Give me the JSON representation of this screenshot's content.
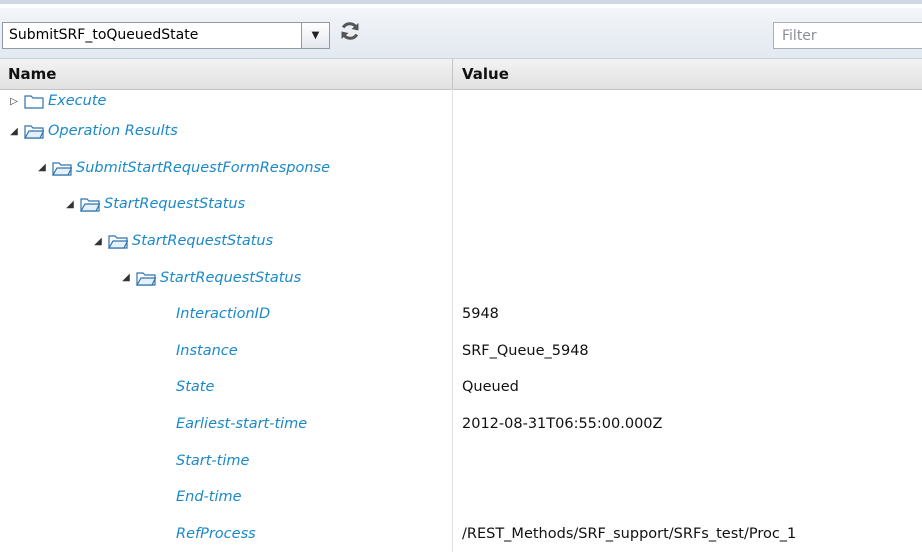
{
  "toolbar": {
    "selected_operation": "SubmitSRF_toQueuedState",
    "filter_placeholder": "Filter",
    "refresh_icon": "refresh-icon"
  },
  "table": {
    "columns": {
      "name": "Name",
      "value": "Value"
    },
    "rows": [
      {
        "label": "Execute",
        "value": "",
        "expander": "collapsed",
        "folder": true
      },
      {
        "label": "Operation Results",
        "value": "",
        "expander": "expanded",
        "folder": true
      },
      {
        "label": "SubmitStartRequestFormResponse",
        "value": "",
        "expander": "expanded",
        "folder": true
      },
      {
        "label": "StartRequestStatus",
        "value": "",
        "expander": "expanded",
        "folder": true
      },
      {
        "label": "StartRequestStatus",
        "value": "",
        "expander": "expanded",
        "folder": true
      },
      {
        "label": "StartRequestStatus",
        "value": "",
        "expander": "expanded",
        "folder": true
      },
      {
        "label": "InteractionID",
        "value": "5948"
      },
      {
        "label": "Instance",
        "value": "SRF_Queue_5948"
      },
      {
        "label": "State",
        "value": "Queued"
      },
      {
        "label": "Earliest-start-time",
        "value": "2012-08-31T06:55:00.000Z"
      },
      {
        "label": "Start-time",
        "value": ""
      },
      {
        "label": "End-time",
        "value": ""
      },
      {
        "label": "RefProcess",
        "value": "/REST_Methods/SRF_support/SRFs_test/Proc_1"
      }
    ]
  },
  "colors": {
    "label": "#1b89c9",
    "header_bg": "#e8e8e8",
    "toolbar_bg": "#e9eef4"
  }
}
